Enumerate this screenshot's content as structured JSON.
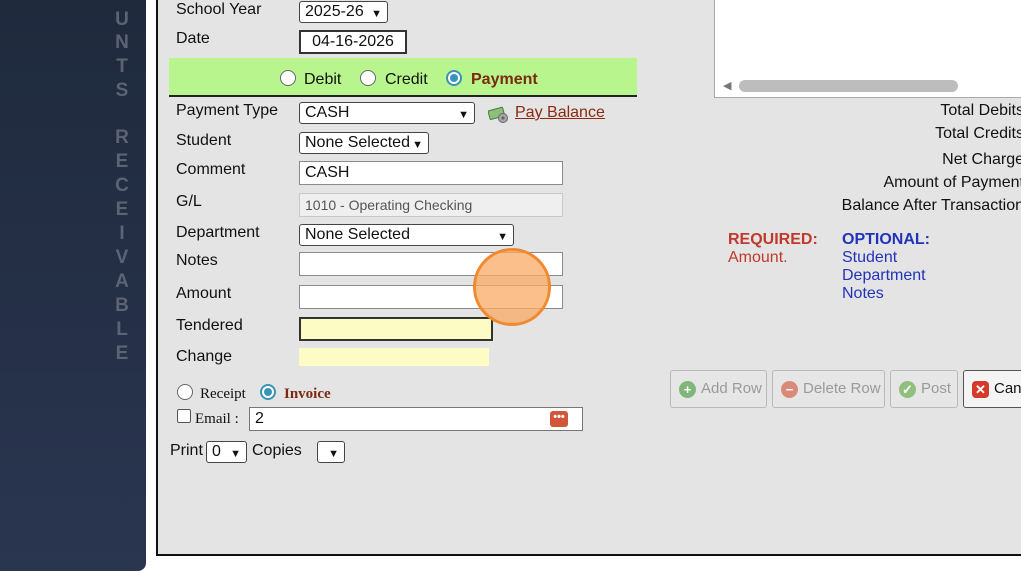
{
  "sidebar": {
    "letters": [
      "U",
      "N",
      "T",
      "S",
      "",
      "R",
      "E",
      "C",
      "E",
      "I",
      "V",
      "A",
      "B",
      "L",
      "E"
    ]
  },
  "form": {
    "school_year_label": "School Year",
    "school_year_value": "2025-26",
    "date_label": "Date",
    "date_value": "04-16-2026",
    "type_options": {
      "debit": "Debit",
      "credit": "Credit",
      "payment": "Payment"
    },
    "payment_type_label": "Payment Type",
    "payment_type_value": "CASH",
    "pay_balance_link": "Pay Balance",
    "student_label": "Student",
    "student_value": "None Selected",
    "comment_label": "Comment",
    "comment_value": "CASH",
    "gl_label": "G/L",
    "gl_value": "1010 - Operating Checking",
    "department_label": "Department",
    "department_value": "None Selected",
    "notes_label": "Notes",
    "notes_value": "",
    "amount_label": "Amount",
    "amount_value": "",
    "tendered_label": "Tendered",
    "tendered_value": "",
    "change_label": "Change",
    "change_value": "",
    "receipt_label": "Receipt",
    "invoice_label": "Invoice",
    "email_label": "Email :",
    "email_value": "2",
    "print_label": "Print",
    "print_value": "0",
    "copies_label": "Copies",
    "copies_value": ""
  },
  "summary": {
    "total_debits": "Total Debits",
    "total_credits": "Total Credits",
    "net_charge": "Net Charge",
    "amount_of_payment": "Amount of Payment",
    "balance_after": "Balance After Transaction"
  },
  "requirements": {
    "required_title": "REQUIRED:",
    "required_items": [
      "Amount."
    ],
    "optional_title": "OPTIONAL:",
    "optional_items": [
      "Student",
      "Department",
      "Notes"
    ]
  },
  "buttons": {
    "add_row": "Add Row",
    "delete_row": "Delete Row",
    "post": "Post",
    "cancel": "Canc"
  },
  "colors": {
    "accent_green": "#b9f58d",
    "required_red": "#c0392b",
    "optional_blue": "#2233bb",
    "payment_brown": "#7a2a10",
    "tendered_yellow": "#fdfcc4"
  }
}
